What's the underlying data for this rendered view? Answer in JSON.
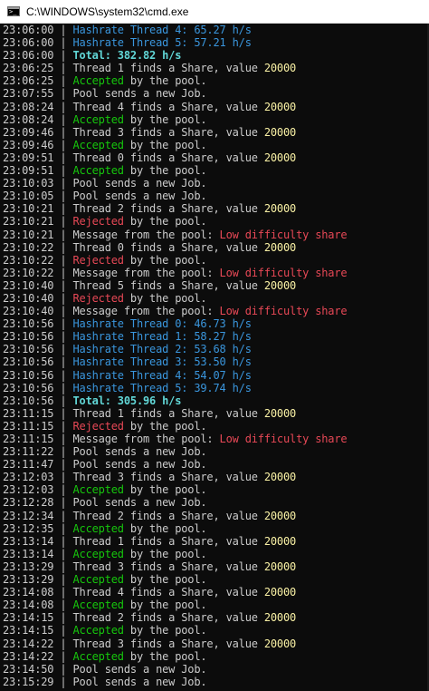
{
  "window": {
    "title": "C:\\WINDOWS\\system32\\cmd.exe",
    "icon": "cmd-icon"
  },
  "colors": {
    "background": "#0c0c0c",
    "default": "#cccccc",
    "hashrate": "#3a96dd",
    "total": "#61d6d6",
    "value": "#f9f1a5",
    "accepted": "#16c60c",
    "rejected": "#e74856"
  },
  "console": {
    "lines": [
      [
        [
          "ts",
          "23:06:00"
        ],
        [
          "pipe",
          " | "
        ],
        [
          "hash",
          "Hashrate Thread 4: 65.27 h/s"
        ]
      ],
      [
        [
          "ts",
          "23:06:00"
        ],
        [
          "pipe",
          " | "
        ],
        [
          "hash",
          "Hashrate Thread 5: 57.21 h/s"
        ]
      ],
      [
        [
          "ts",
          "23:06:00"
        ],
        [
          "pipe",
          " | "
        ],
        [
          "total",
          "Total: 382.82 h/s"
        ]
      ],
      [
        [
          "ts",
          "23:06:25"
        ],
        [
          "pipe",
          " | "
        ],
        [
          "normal",
          "Thread 1 finds a Share, value "
        ],
        [
          "value",
          "20000"
        ]
      ],
      [
        [
          "ts",
          "23:06:25"
        ],
        [
          "pipe",
          " | "
        ],
        [
          "accepted",
          "Accepted"
        ],
        [
          "normal",
          " by the pool."
        ]
      ],
      [
        [
          "ts",
          "23:07:55"
        ],
        [
          "pipe",
          " | "
        ],
        [
          "normal",
          "Pool sends a new Job."
        ]
      ],
      [
        [
          "ts",
          "23:08:24"
        ],
        [
          "pipe",
          " | "
        ],
        [
          "normal",
          "Thread 4 finds a Share, value "
        ],
        [
          "value",
          "20000"
        ]
      ],
      [
        [
          "ts",
          "23:08:24"
        ],
        [
          "pipe",
          " | "
        ],
        [
          "accepted",
          "Accepted"
        ],
        [
          "normal",
          " by the pool."
        ]
      ],
      [
        [
          "ts",
          "23:09:46"
        ],
        [
          "pipe",
          " | "
        ],
        [
          "normal",
          "Thread 3 finds a Share, value "
        ],
        [
          "value",
          "20000"
        ]
      ],
      [
        [
          "ts",
          "23:09:46"
        ],
        [
          "pipe",
          " | "
        ],
        [
          "accepted",
          "Accepted"
        ],
        [
          "normal",
          " by the pool."
        ]
      ],
      [
        [
          "ts",
          "23:09:51"
        ],
        [
          "pipe",
          " | "
        ],
        [
          "normal",
          "Thread 0 finds a Share, value "
        ],
        [
          "value",
          "20000"
        ]
      ],
      [
        [
          "ts",
          "23:09:51"
        ],
        [
          "pipe",
          " | "
        ],
        [
          "accepted",
          "Accepted"
        ],
        [
          "normal",
          " by the pool."
        ]
      ],
      [
        [
          "ts",
          "23:10:03"
        ],
        [
          "pipe",
          " | "
        ],
        [
          "normal",
          "Pool sends a new Job."
        ]
      ],
      [
        [
          "ts",
          "23:10:05"
        ],
        [
          "pipe",
          " | "
        ],
        [
          "normal",
          "Pool sends a new Job."
        ]
      ],
      [
        [
          "ts",
          "23:10:21"
        ],
        [
          "pipe",
          " | "
        ],
        [
          "normal",
          "Thread 2 finds a Share, value "
        ],
        [
          "value",
          "20000"
        ]
      ],
      [
        [
          "ts",
          "23:10:21"
        ],
        [
          "pipe",
          " | "
        ],
        [
          "rejected",
          "Rejected"
        ],
        [
          "normal",
          " by the pool."
        ]
      ],
      [
        [
          "ts",
          "23:10:21"
        ],
        [
          "pipe",
          " | "
        ],
        [
          "normal",
          "Message from the pool: "
        ],
        [
          "rejected",
          "Low difficulty share"
        ]
      ],
      [
        [
          "ts",
          "23:10:22"
        ],
        [
          "pipe",
          " | "
        ],
        [
          "normal",
          "Thread 0 finds a Share, value "
        ],
        [
          "value",
          "20000"
        ]
      ],
      [
        [
          "ts",
          "23:10:22"
        ],
        [
          "pipe",
          " | "
        ],
        [
          "rejected",
          "Rejected"
        ],
        [
          "normal",
          " by the pool."
        ]
      ],
      [
        [
          "ts",
          "23:10:22"
        ],
        [
          "pipe",
          " | "
        ],
        [
          "normal",
          "Message from the pool: "
        ],
        [
          "rejected",
          "Low difficulty share"
        ]
      ],
      [
        [
          "ts",
          "23:10:40"
        ],
        [
          "pipe",
          " | "
        ],
        [
          "normal",
          "Thread 5 finds a Share, value "
        ],
        [
          "value",
          "20000"
        ]
      ],
      [
        [
          "ts",
          "23:10:40"
        ],
        [
          "pipe",
          " | "
        ],
        [
          "rejected",
          "Rejected"
        ],
        [
          "normal",
          " by the pool."
        ]
      ],
      [
        [
          "ts",
          "23:10:40"
        ],
        [
          "pipe",
          " | "
        ],
        [
          "normal",
          "Message from the pool: "
        ],
        [
          "rejected",
          "Low difficulty share"
        ]
      ],
      [
        [
          "ts",
          "23:10:56"
        ],
        [
          "pipe",
          " | "
        ],
        [
          "hash",
          "Hashrate Thread 0: 46.73 h/s"
        ]
      ],
      [
        [
          "ts",
          "23:10:56"
        ],
        [
          "pipe",
          " | "
        ],
        [
          "hash",
          "Hashrate Thread 1: 58.27 h/s"
        ]
      ],
      [
        [
          "ts",
          "23:10:56"
        ],
        [
          "pipe",
          " | "
        ],
        [
          "hash",
          "Hashrate Thread 2: 53.68 h/s"
        ]
      ],
      [
        [
          "ts",
          "23:10:56"
        ],
        [
          "pipe",
          " | "
        ],
        [
          "hash",
          "Hashrate Thread 3: 53.50 h/s"
        ]
      ],
      [
        [
          "ts",
          "23:10:56"
        ],
        [
          "pipe",
          " | "
        ],
        [
          "hash",
          "Hashrate Thread 4: 54.07 h/s"
        ]
      ],
      [
        [
          "ts",
          "23:10:56"
        ],
        [
          "pipe",
          " | "
        ],
        [
          "hash",
          "Hashrate Thread 5: 39.74 h/s"
        ]
      ],
      [
        [
          "ts",
          "23:10:56"
        ],
        [
          "pipe",
          " | "
        ],
        [
          "total",
          "Total: 305.96 h/s"
        ]
      ],
      [
        [
          "ts",
          "23:11:15"
        ],
        [
          "pipe",
          " | "
        ],
        [
          "normal",
          "Thread 1 finds a Share, value "
        ],
        [
          "value",
          "20000"
        ]
      ],
      [
        [
          "ts",
          "23:11:15"
        ],
        [
          "pipe",
          " | "
        ],
        [
          "rejected",
          "Rejected"
        ],
        [
          "normal",
          " by the pool."
        ]
      ],
      [
        [
          "ts",
          "23:11:15"
        ],
        [
          "pipe",
          " | "
        ],
        [
          "normal",
          "Message from the pool: "
        ],
        [
          "rejected",
          "Low difficulty share"
        ]
      ],
      [
        [
          "ts",
          "23:11:22"
        ],
        [
          "pipe",
          " | "
        ],
        [
          "normal",
          "Pool sends a new Job."
        ]
      ],
      [
        [
          "ts",
          "23:11:47"
        ],
        [
          "pipe",
          " | "
        ],
        [
          "normal",
          "Pool sends a new Job."
        ]
      ],
      [
        [
          "ts",
          "23:12:03"
        ],
        [
          "pipe",
          " | "
        ],
        [
          "normal",
          "Thread 3 finds a Share, value "
        ],
        [
          "value",
          "20000"
        ]
      ],
      [
        [
          "ts",
          "23:12:03"
        ],
        [
          "pipe",
          " | "
        ],
        [
          "accepted",
          "Accepted"
        ],
        [
          "normal",
          " by the pool."
        ]
      ],
      [
        [
          "ts",
          "23:12:28"
        ],
        [
          "pipe",
          " | "
        ],
        [
          "normal",
          "Pool sends a new Job."
        ]
      ],
      [
        [
          "ts",
          "23:12:34"
        ],
        [
          "pipe",
          " | "
        ],
        [
          "normal",
          "Thread 2 finds a Share, value "
        ],
        [
          "value",
          "20000"
        ]
      ],
      [
        [
          "ts",
          "23:12:35"
        ],
        [
          "pipe",
          " | "
        ],
        [
          "accepted",
          "Accepted"
        ],
        [
          "normal",
          " by the pool."
        ]
      ],
      [
        [
          "ts",
          "23:13:14"
        ],
        [
          "pipe",
          " | "
        ],
        [
          "normal",
          "Thread 1 finds a Share, value "
        ],
        [
          "value",
          "20000"
        ]
      ],
      [
        [
          "ts",
          "23:13:14"
        ],
        [
          "pipe",
          " | "
        ],
        [
          "accepted",
          "Accepted"
        ],
        [
          "normal",
          " by the pool."
        ]
      ],
      [
        [
          "ts",
          "23:13:29"
        ],
        [
          "pipe",
          " | "
        ],
        [
          "normal",
          "Thread 3 finds a Share, value "
        ],
        [
          "value",
          "20000"
        ]
      ],
      [
        [
          "ts",
          "23:13:29"
        ],
        [
          "pipe",
          " | "
        ],
        [
          "accepted",
          "Accepted"
        ],
        [
          "normal",
          " by the pool."
        ]
      ],
      [
        [
          "ts",
          "23:14:08"
        ],
        [
          "pipe",
          " | "
        ],
        [
          "normal",
          "Thread 4 finds a Share, value "
        ],
        [
          "value",
          "20000"
        ]
      ],
      [
        [
          "ts",
          "23:14:08"
        ],
        [
          "pipe",
          " | "
        ],
        [
          "accepted",
          "Accepted"
        ],
        [
          "normal",
          " by the pool."
        ]
      ],
      [
        [
          "ts",
          "23:14:15"
        ],
        [
          "pipe",
          " | "
        ],
        [
          "normal",
          "Thread 2 finds a Share, value "
        ],
        [
          "value",
          "20000"
        ]
      ],
      [
        [
          "ts",
          "23:14:15"
        ],
        [
          "pipe",
          " | "
        ],
        [
          "accepted",
          "Accepted"
        ],
        [
          "normal",
          " by the pool."
        ]
      ],
      [
        [
          "ts",
          "23:14:22"
        ],
        [
          "pipe",
          " | "
        ],
        [
          "normal",
          "Thread 3 finds a Share, value "
        ],
        [
          "value",
          "20000"
        ]
      ],
      [
        [
          "ts",
          "23:14:22"
        ],
        [
          "pipe",
          " | "
        ],
        [
          "accepted",
          "Accepted"
        ],
        [
          "normal",
          " by the pool."
        ]
      ],
      [
        [
          "ts",
          "23:14:50"
        ],
        [
          "pipe",
          " | "
        ],
        [
          "normal",
          "Pool sends a new Job."
        ]
      ],
      [
        [
          "ts",
          "23:15:29"
        ],
        [
          "pipe",
          " | "
        ],
        [
          "normal",
          "Pool sends a new Job."
        ]
      ]
    ]
  }
}
